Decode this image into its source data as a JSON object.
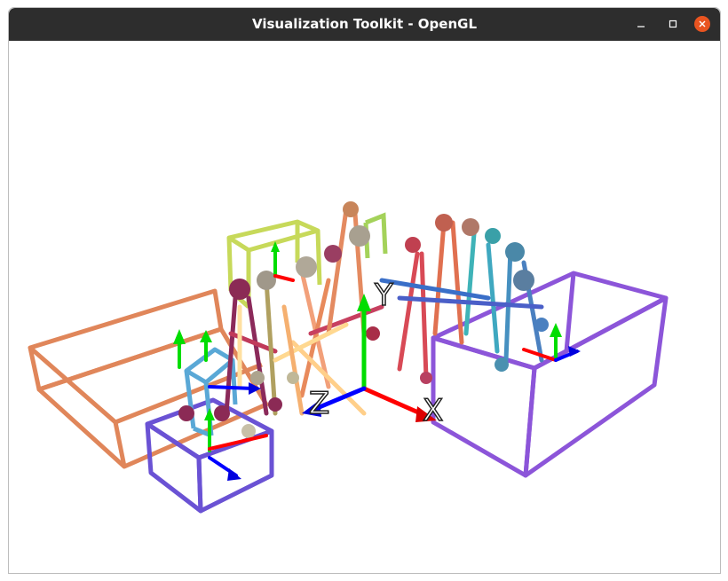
{
  "window": {
    "title": "Visualization Toolkit - OpenGL",
    "controls": {
      "minimize": "minimize-icon",
      "maximize": "maximize-icon",
      "close": "close-icon"
    },
    "close_color": "#e95420"
  },
  "scene": {
    "background": "#ffffff",
    "axes_labels": {
      "x": "X",
      "y": "Y",
      "z": "Z"
    },
    "axis_colors": {
      "x": "#ff0000",
      "y": "#00dd00",
      "z": "#0000ff"
    },
    "box_colors": [
      "#e0865a",
      "#c7d95a",
      "#6a52d4",
      "#8c55d9",
      "#5aa8d6"
    ]
  }
}
